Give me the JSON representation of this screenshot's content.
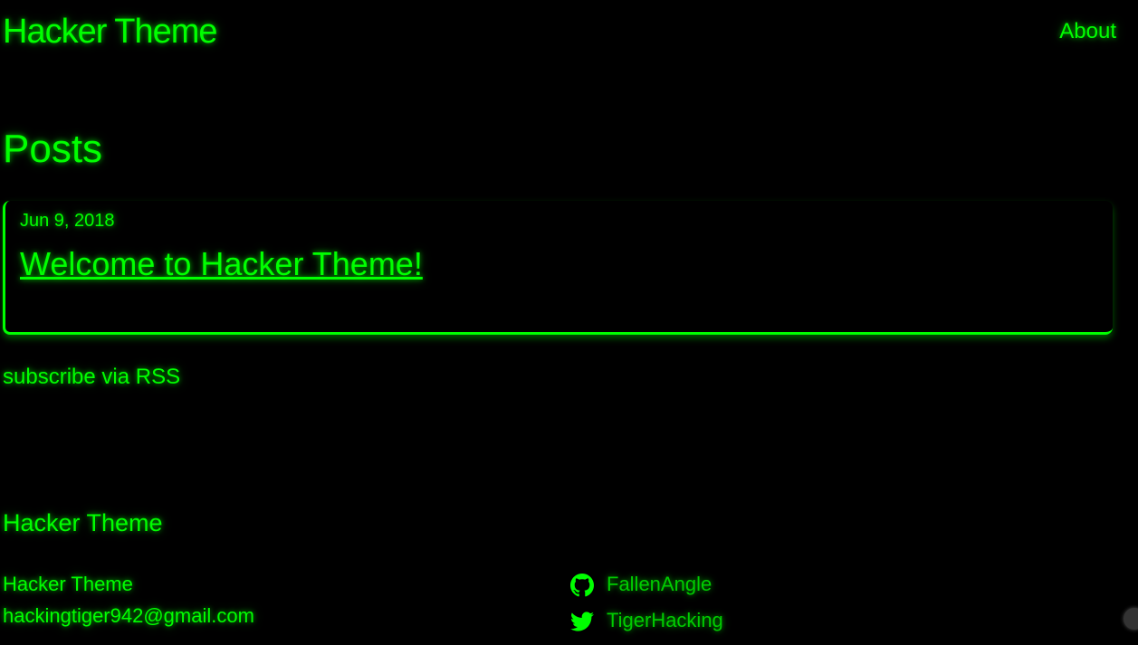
{
  "header": {
    "site_title": "Hacker Theme",
    "nav": [
      {
        "label": "About"
      }
    ]
  },
  "main": {
    "page_heading": "Posts",
    "posts": [
      {
        "date": "Jun 9, 2018",
        "title": "Welcome to Hacker Theme!"
      }
    ],
    "rss_link": "subscribe via RSS"
  },
  "footer": {
    "heading": "Hacker Theme",
    "name": "Hacker Theme",
    "email": "hackingtiger942@gmail.com",
    "social": [
      {
        "icon": "github-icon",
        "label": "FallenAngle"
      },
      {
        "icon": "twitter-icon",
        "label": "TigerHacking"
      }
    ]
  },
  "colors": {
    "background": "#000000",
    "accent": "#00ff00"
  }
}
